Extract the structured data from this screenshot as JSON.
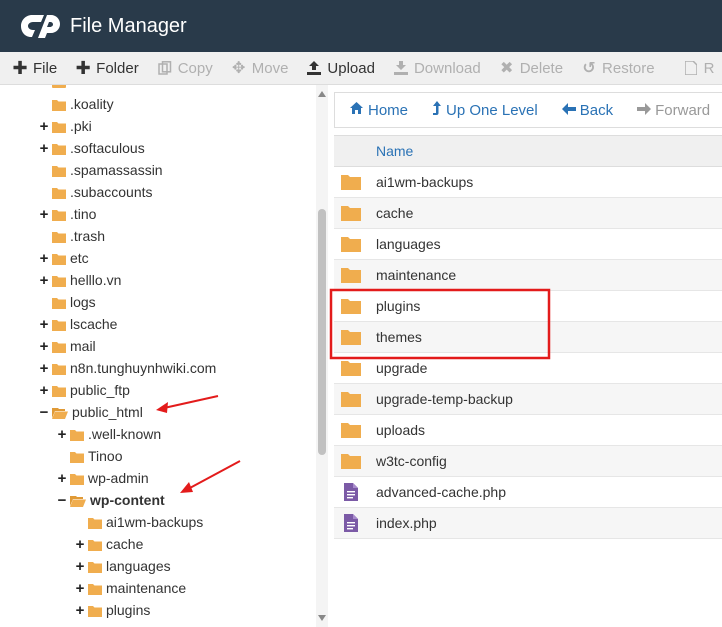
{
  "header": {
    "title": "File Manager",
    "logo": "cpanel-logo"
  },
  "toolbar": {
    "items": [
      {
        "label": "File",
        "icon": "plus-icon",
        "enabled": true
      },
      {
        "label": "Folder",
        "icon": "plus-icon",
        "enabled": true
      },
      {
        "label": "Copy",
        "icon": "copy-icon",
        "enabled": false
      },
      {
        "label": "Move",
        "icon": "move-icon",
        "enabled": false
      },
      {
        "label": "Upload",
        "icon": "upload-icon",
        "enabled": true
      },
      {
        "label": "Download",
        "icon": "download-icon",
        "enabled": false
      },
      {
        "label": "Delete",
        "icon": "delete-icon",
        "enabled": false
      },
      {
        "label": "Restore",
        "icon": "restore-icon",
        "enabled": false
      },
      {
        "label": "R",
        "icon": "file-icon",
        "enabled": false
      }
    ]
  },
  "tree": {
    "items": [
      {
        "label": ".koality",
        "level": 0,
        "expand": "none"
      },
      {
        "label": ".pki",
        "level": 0,
        "expand": "plus"
      },
      {
        "label": ".softaculous",
        "level": 0,
        "expand": "plus"
      },
      {
        "label": ".spamassassin",
        "level": 0,
        "expand": "none"
      },
      {
        "label": ".subaccounts",
        "level": 0,
        "expand": "none"
      },
      {
        "label": ".tino",
        "level": 0,
        "expand": "plus"
      },
      {
        "label": ".trash",
        "level": 0,
        "expand": "none"
      },
      {
        "label": "etc",
        "level": 0,
        "expand": "plus"
      },
      {
        "label": "helllo.vn",
        "level": 0,
        "expand": "plus"
      },
      {
        "label": "logs",
        "level": 0,
        "expand": "none"
      },
      {
        "label": "lscache",
        "level": 0,
        "expand": "plus"
      },
      {
        "label": "mail",
        "level": 0,
        "expand": "plus"
      },
      {
        "label": "n8n.tunghuynhwiki.com",
        "level": 0,
        "expand": "plus"
      },
      {
        "label": "public_ftp",
        "level": 0,
        "expand": "plus"
      },
      {
        "label": "public_html",
        "level": 0,
        "expand": "minus"
      },
      {
        "label": ".well-known",
        "level": 1,
        "expand": "plus"
      },
      {
        "label": "Tinoo",
        "level": 1,
        "expand": "none"
      },
      {
        "label": "wp-admin",
        "level": 1,
        "expand": "plus"
      },
      {
        "label": "wp-content",
        "level": 1,
        "expand": "minus",
        "bold": true
      },
      {
        "label": "ai1wm-backups",
        "level": 2,
        "expand": "none"
      },
      {
        "label": "cache",
        "level": 2,
        "expand": "plus"
      },
      {
        "label": "languages",
        "level": 2,
        "expand": "plus"
      },
      {
        "label": "maintenance",
        "level": 2,
        "expand": "plus"
      },
      {
        "label": "plugins",
        "level": 2,
        "expand": "plus"
      }
    ]
  },
  "nav": {
    "home": "Home",
    "up": "Up One Level",
    "back": "Back",
    "forward": "Forward"
  },
  "list": {
    "column_name": "Name",
    "rows": [
      {
        "name": "ai1wm-backups",
        "type": "folder"
      },
      {
        "name": "cache",
        "type": "folder"
      },
      {
        "name": "languages",
        "type": "folder"
      },
      {
        "name": "maintenance",
        "type": "folder"
      },
      {
        "name": "plugins",
        "type": "folder"
      },
      {
        "name": "themes",
        "type": "folder"
      },
      {
        "name": "upgrade",
        "type": "folder"
      },
      {
        "name": "upgrade-temp-backup",
        "type": "folder"
      },
      {
        "name": "uploads",
        "type": "folder"
      },
      {
        "name": "w3tc-config",
        "type": "folder"
      },
      {
        "name": "advanced-cache.php",
        "type": "file"
      },
      {
        "name": "index.php",
        "type": "file"
      }
    ]
  },
  "colors": {
    "header_bg": "#293a4a",
    "folder": "#f0ad4e",
    "link": "#2a72b5",
    "file_icon": "#7b5aa6",
    "annotation": "#e31b1b"
  }
}
